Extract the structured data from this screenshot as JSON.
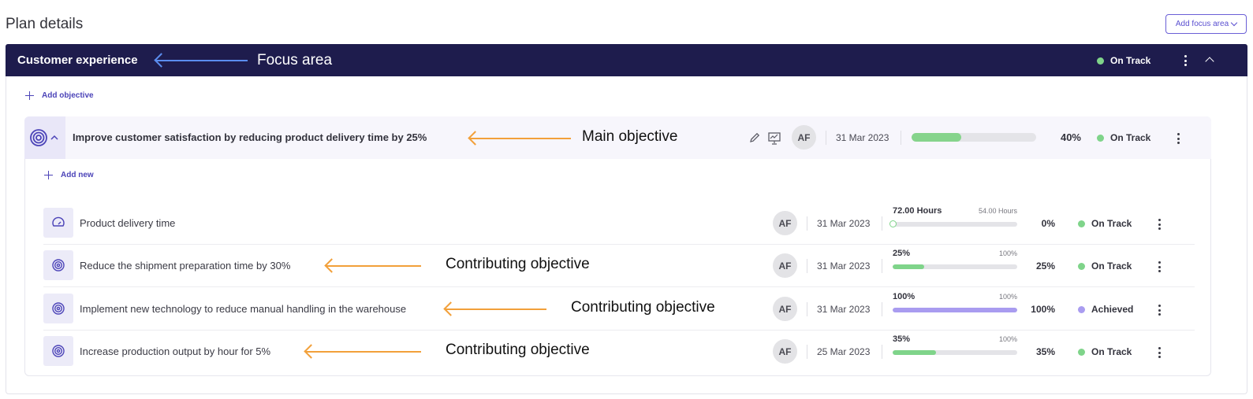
{
  "page": {
    "title": "Plan details",
    "add_focus_label": "Add focus area"
  },
  "focus_area": {
    "name": "Customer experience",
    "status": "On Track",
    "colors": {
      "bar_bg": "#1e1c4d",
      "on_track": "#7fd48a"
    }
  },
  "add_objective_label": "Add objective",
  "main_objective": {
    "title": "Improve customer satisfaction by reducing product delivery time by 25%",
    "owner": "AF",
    "date": "31 Mar 2023",
    "progress_label": "40%",
    "progress": 0.4,
    "status": "On Track"
  },
  "add_new_label": "Add new",
  "contributing": [
    {
      "title": "Product delivery time",
      "icon": "speedometer-icon",
      "owner": "AF",
      "date": "31 Mar 2023",
      "current": "72.00 Hours",
      "target": "54.00 Hours",
      "percent": "0%",
      "progress": 0,
      "status": "On Track",
      "status_color": "#7fd48a",
      "fill_color": "#7fd48a"
    },
    {
      "title": "Reduce the shipment preparation time by 30%",
      "icon": "target-icon",
      "owner": "AF",
      "date": "31 Mar 2023",
      "current": "25%",
      "target": "100%",
      "percent": "25%",
      "progress": 0.25,
      "status": "On Track",
      "status_color": "#7fd48a",
      "fill_color": "#7fd48a"
    },
    {
      "title": "Implement new technology to reduce manual handling in the warehouse",
      "icon": "target-icon",
      "owner": "AF",
      "date": "31 Mar 2023",
      "current": "100%",
      "target": "100%",
      "percent": "100%",
      "progress": 1.0,
      "status": "Achieved",
      "status_color": "#a99cf0",
      "fill_color": "#a99cf0"
    },
    {
      "title": "Increase production output by hour for 5%",
      "icon": "target-icon",
      "owner": "AF",
      "date": "25 Mar 2023",
      "current": "35%",
      "target": "100%",
      "percent": "35%",
      "progress": 0.35,
      "status": "On Track",
      "status_color": "#7fd48a",
      "fill_color": "#7fd48a"
    }
  ],
  "annotations": {
    "focus_area": "Focus area",
    "main_objective": "Main objective",
    "contributing_1": "Contributing objective",
    "contributing_2": "Contributing objective",
    "contributing_3": "Contributing objective"
  }
}
